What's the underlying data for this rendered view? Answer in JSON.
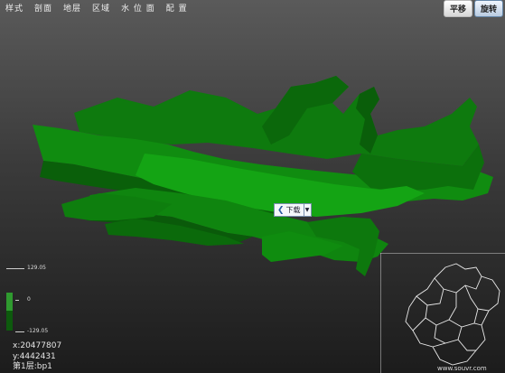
{
  "menu": [
    {
      "id": "style",
      "label": "样式"
    },
    {
      "id": "section",
      "label": "剖面"
    },
    {
      "id": "layer",
      "label": "地层"
    },
    {
      "id": "region",
      "label": "区域"
    },
    {
      "id": "water",
      "label": "水 位 面"
    },
    {
      "id": "config",
      "label": "配  置"
    }
  ],
  "mode_buttons": {
    "pan": "平移",
    "rotate": "旋转",
    "active": "rotate"
  },
  "download": {
    "label": "下载"
  },
  "legend": {
    "max": "129.05",
    "mid": "0",
    "min": "-129.05"
  },
  "coords": {
    "x": "x:20477807",
    "y": "y:4442431",
    "layer": "第1层:bp1"
  },
  "watermark": "www.souvr.com",
  "colors": {
    "model_top": "#0f8a0f",
    "model_side": "#0a5f0a",
    "legend_top": "#2f9a2f",
    "legend_bottom": "#0d5a0d"
  }
}
